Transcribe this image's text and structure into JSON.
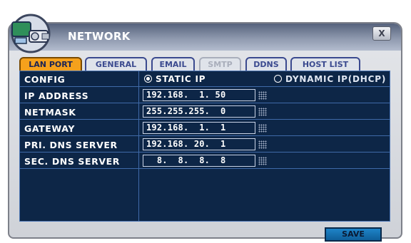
{
  "window": {
    "title": "NETWORK",
    "close_label": "X"
  },
  "tabs": [
    {
      "label": "LAN PORT",
      "state": "active"
    },
    {
      "label": "GENERAL",
      "state": "normal"
    },
    {
      "label": "EMAIL",
      "state": "normal"
    },
    {
      "label": "SMTP",
      "state": "disabled"
    },
    {
      "label": "DDNS",
      "state": "normal"
    },
    {
      "label": "HOST LIST",
      "state": "normal"
    }
  ],
  "form": {
    "config_label": "CONFIG",
    "static_ip_label": "STATIC IP",
    "dynamic_ip_label": "DYNAMIC IP(DHCP)",
    "selected": "STATIC IP",
    "rows": [
      {
        "label": "IP ADDRESS",
        "value": "192.168.  1. 50"
      },
      {
        "label": "NETMASK",
        "value": "255.255.255.  0"
      },
      {
        "label": "GATEWAY",
        "value": "192.168.  1.  1"
      },
      {
        "label": "PRI. DNS SERVER",
        "value": "192.168. 20.  1"
      },
      {
        "label": "SEC. DNS SERVER",
        "value": "  8.  8.  8.  8"
      }
    ]
  },
  "footer": {
    "save_label": "SAVE"
  },
  "colors": {
    "panel_bg": "#0d2647",
    "active_tab": "#f5a11c",
    "save_button": "#1e84c8"
  },
  "icons": {
    "logo": "network-cameras-logo",
    "keyboard": "virtual-keyboard-icon"
  }
}
